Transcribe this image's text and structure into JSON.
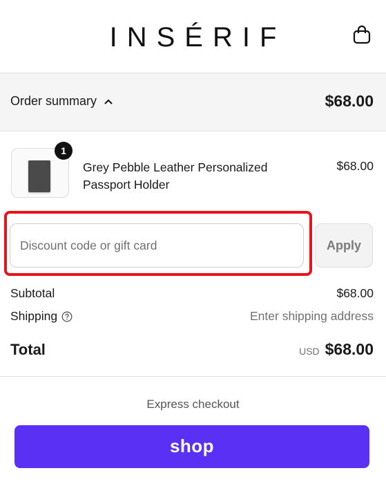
{
  "header": {
    "logo": "INSÉRIF",
    "bag_icon": "shopping-bag-icon"
  },
  "summary": {
    "toggle_label": "Order summary",
    "chevron_icon": "chevron-up-icon",
    "total": "$68.00"
  },
  "item": {
    "quantity": "1",
    "name": "Grey Pebble Leather Personalized Passport Holder",
    "price": "$68.00"
  },
  "discount": {
    "placeholder": "Discount code or gift card",
    "apply_label": "Apply"
  },
  "totals": {
    "subtotal_label": "Subtotal",
    "subtotal_value": "$68.00",
    "shipping_label": "Shipping",
    "shipping_value": "Enter shipping address",
    "help_icon": "question-circle-icon",
    "total_label": "Total",
    "currency": "USD",
    "total_value": "$68.00"
  },
  "checkout": {
    "express_label": "Express checkout",
    "shop_label": "shop"
  },
  "colors": {
    "highlight": "#e8141b",
    "shop_pay": "#5a31f4"
  }
}
